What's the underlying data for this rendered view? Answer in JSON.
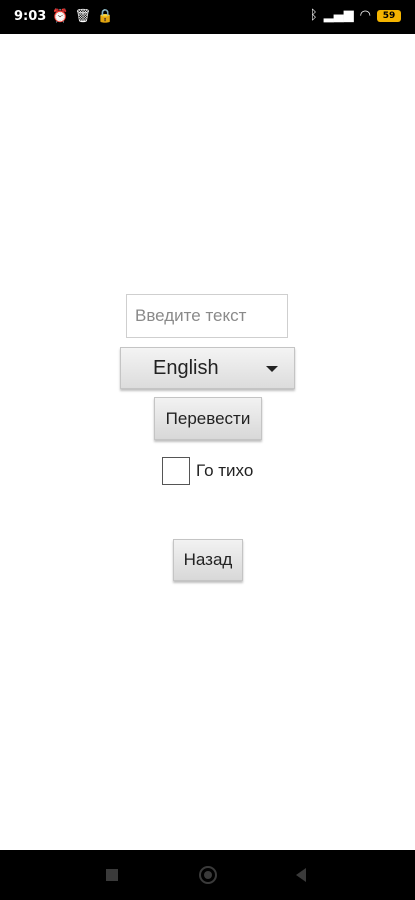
{
  "status_bar": {
    "time": "9:03",
    "left_icons": [
      "alarm-icon",
      "trash-icon",
      "lock-icon"
    ],
    "right_icons": [
      "bluetooth-icon",
      "signal-icon",
      "wifi-icon"
    ],
    "battery_level": "59"
  },
  "form": {
    "text_input": {
      "placeholder": "Введите текст",
      "value": ""
    },
    "language_select": {
      "selected": "English"
    },
    "translate_button": "Перевести",
    "quiet_checkbox": {
      "label": "Го тихо",
      "checked": false
    },
    "back_button": "Назад"
  },
  "nav_bar": {
    "buttons": [
      "recents-icon",
      "home-icon",
      "back-icon"
    ]
  },
  "colors": {
    "status_bar_bg": "#000000",
    "battery": "#f4b400",
    "button_bg": "#e6e6e6"
  }
}
